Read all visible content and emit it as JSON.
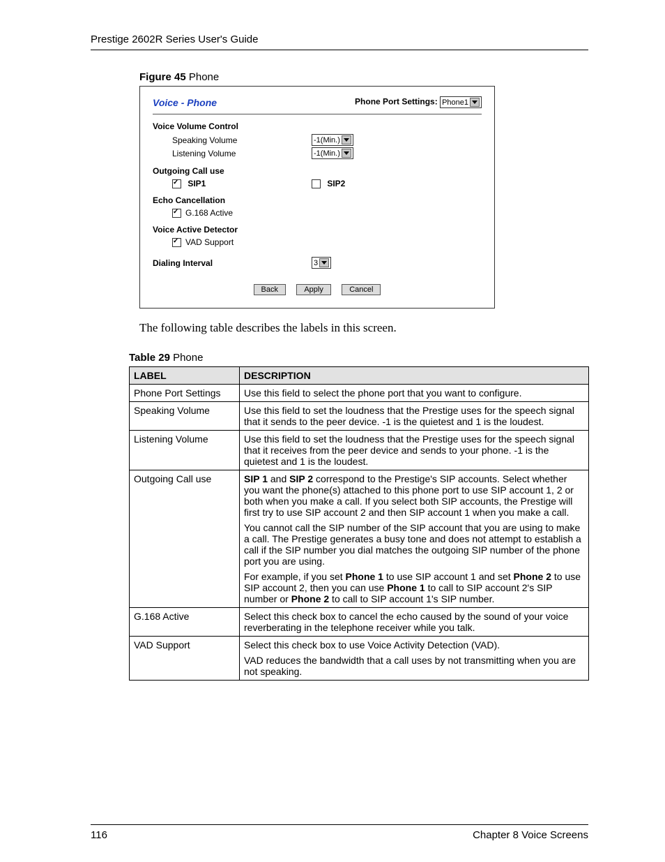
{
  "header_text": "Prestige 2602R Series User's Guide",
  "figure_caption_bold": "Figure 45",
  "figure_caption_rest": "   Phone",
  "fig": {
    "title": "Voice - Phone",
    "port_label": "Phone Port Settings:",
    "port_value": "Phone1",
    "sec_vvc": "Voice Volume Control",
    "speaking_label": "Speaking Volume",
    "speaking_value": "-1(Min.)",
    "listening_label": "Listening Volume",
    "listening_value": "-1(Min.)",
    "sec_out": "Outgoing Call use",
    "sip1_label": "SIP1",
    "sip2_label": "SIP2",
    "sec_echo": "Echo Cancellation",
    "g168_label": "G.168 Active",
    "sec_vad": "Voice Active Detector",
    "vad_label": "VAD Support",
    "sec_dial": "Dialing Interval",
    "dial_value": "3",
    "btn_back": "Back",
    "btn_apply": "Apply",
    "btn_cancel": "Cancel"
  },
  "intro": "The following table describes the labels in this screen.",
  "table_caption_bold": "Table 29",
  "table_caption_rest": "   Phone",
  "thead_label": "LABEL",
  "thead_desc": "DESCRIPTION",
  "rows": [
    {
      "label": "Phone Port Settings",
      "desc": "Use this field to select the phone port that you want to configure."
    },
    {
      "label": "Speaking Volume",
      "desc": "Use this field to set the loudness that the Prestige uses for the speech signal that it sends to the peer device. -1 is the quietest and 1 is the loudest."
    },
    {
      "label": "Listening Volume",
      "desc": "Use this field to set the loudness that the Prestige uses for the speech signal that it receives from the peer device and sends to your phone. -1 is the quietest and 1 is the loudest."
    }
  ],
  "row_outgoing": {
    "label": "Outgoing Call use",
    "p1_pre": "",
    "sip1": "SIP 1",
    "mid1": " and ",
    "sip2": "SIP 2",
    "p1_rest": " correspond to the Prestige's SIP accounts. Select whether you want the phone(s) attached to this phone port to use SIP account 1, 2 or both when you make a call. If you select both SIP accounts, the Prestige will first try to use SIP account 2 and then SIP account 1 when you make a call.",
    "p2": "You cannot call the SIP number of the SIP account that you are using to make a call.  The Prestige generates a busy tone and does not attempt to establish a call if the SIP number you dial matches the outgoing SIP number of the phone port you are using.",
    "p3_a": "For example, if you set ",
    "phone1": "Phone 1",
    "p3_b": " to use SIP account 1 and set ",
    "phone2": "Phone 2",
    "p3_c": " to use SIP account 2, then you can use ",
    "p3_phone1b": "Phone 1",
    "p3_d": " to call to SIP account 2's SIP number or ",
    "p3_phone2b": "Phone 2",
    "p3_e": " to call to SIP account 1's SIP number."
  },
  "row_g168": {
    "label": "G.168 Active",
    "desc": "Select this check box to cancel the echo caused by the sound of your voice reverberating in the telephone receiver while you talk."
  },
  "row_vad": {
    "label": "VAD Support",
    "p1": "Select this check box to use Voice Activity Detection (VAD).",
    "p2": "VAD reduces the bandwidth that a call uses by not transmitting when you are not speaking."
  },
  "footer_page": "116",
  "footer_chapter": "Chapter 8 Voice Screens"
}
